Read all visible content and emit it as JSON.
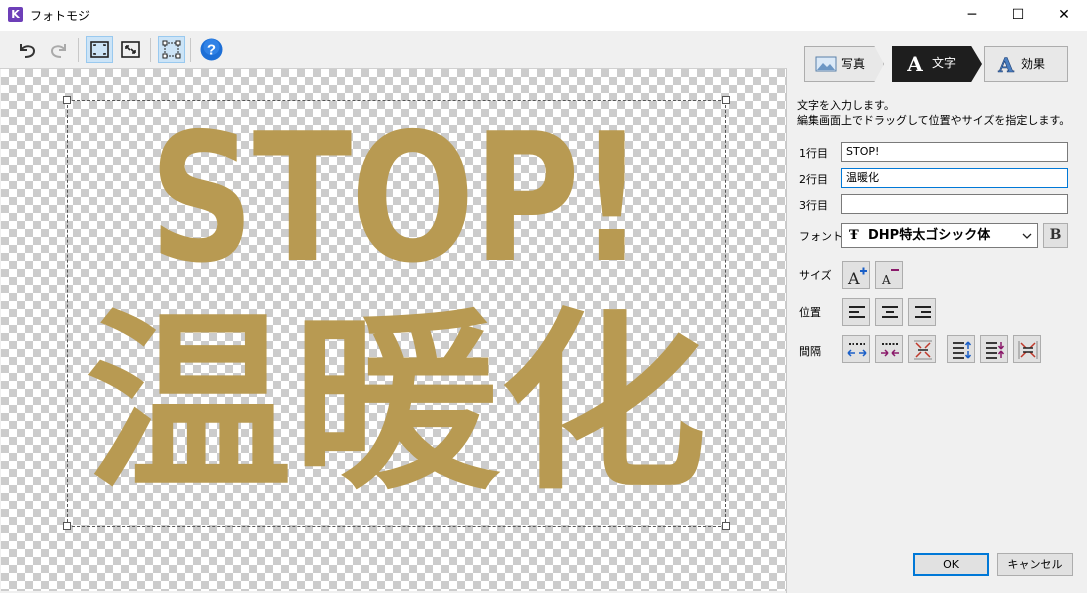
{
  "window": {
    "title": "フォトモジ",
    "minimize": "─",
    "maximize": "☐",
    "close": "✕"
  },
  "toolbar": {
    "icons": [
      "undo-icon",
      "redo-icon",
      "fit-to-window-icon",
      "actual-size-icon",
      "selection-frame-icon",
      "help-icon"
    ],
    "help_glyph": "?"
  },
  "canvas": {
    "line1": "STOP!",
    "line2": "温暖化",
    "text_color": "#b89a52"
  },
  "tabs": {
    "photo": "写真",
    "text": "文字",
    "effect": "効果",
    "active": "文字"
  },
  "panel": {
    "desc_line1": "文字を入力します。",
    "desc_line2": "編集画面上でドラッグして位置やサイズを指定します。",
    "row1_label": "1行目",
    "row1_value": "STOP!",
    "row2_label": "2行目",
    "row2_value": "温暖化",
    "row3_label": "3行目",
    "row3_value": "",
    "font_label": "フォント",
    "font_value": "DHP特太ゴシック体",
    "font_icon": "Ŧ",
    "bold_label": "B",
    "size_label": "サイズ",
    "position_label": "位置",
    "spacing_label": "間隔"
  },
  "buttons": {
    "ok": "OK",
    "cancel": "キャンセル"
  },
  "colors": {
    "accent": "#0078d7",
    "active_tab": "#1e1e1e",
    "help_blue": "#1d6fd6"
  }
}
